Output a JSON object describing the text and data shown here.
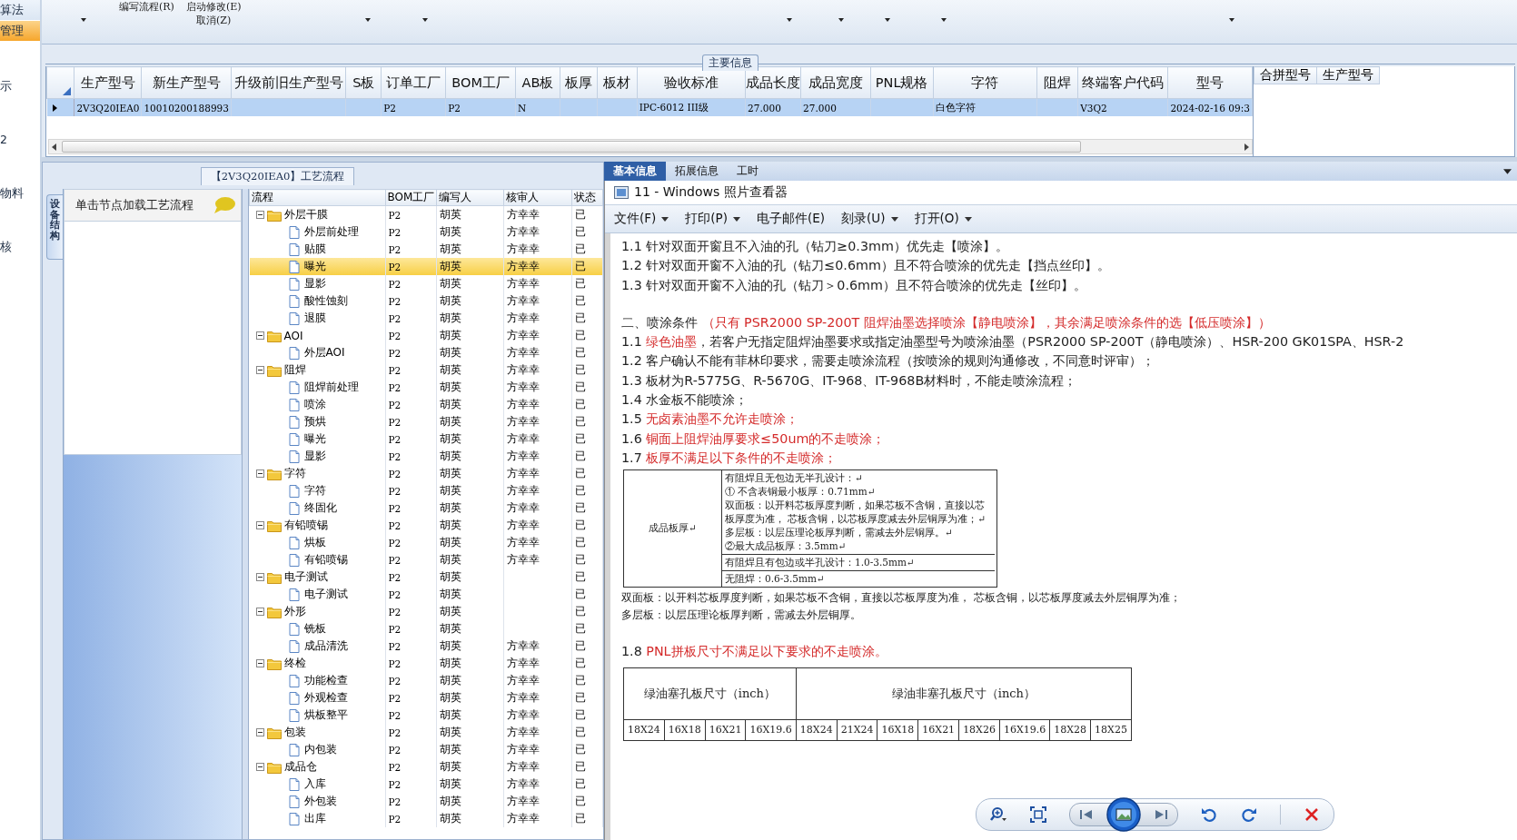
{
  "sidebar": {
    "items": [
      {
        "label": "算法",
        "selected": false
      },
      {
        "label": "管理",
        "selected": true
      },
      {
        "label": "示",
        "selected": false
      },
      {
        "label": "2",
        "selected": false
      },
      {
        "label": "物料",
        "selected": false
      },
      {
        "label": "核",
        "selected": false
      }
    ]
  },
  "toolbar": {
    "items": [
      {
        "kind": "arrow"
      },
      {
        "kind": "label",
        "lines": [
          "编写流程(R)"
        ]
      },
      {
        "kind": "label",
        "lines": [
          "启动修改(E)",
          "取消(Z)"
        ]
      },
      {
        "kind": "arrow"
      },
      {
        "kind": "arrow"
      },
      {
        "kind": "arrow"
      },
      {
        "kind": "arrow"
      },
      {
        "kind": "arrow"
      },
      {
        "kind": "arrow"
      },
      {
        "kind": "arrow"
      }
    ]
  },
  "main_info": {
    "title": "主要信息",
    "columns": [
      "生产型号",
      "新生产型号",
      "升级前旧生产型号",
      "S板",
      "订单工厂",
      "BOM工厂",
      "AB板",
      "板厚",
      "板材",
      "验收标准",
      "成品长度",
      "成品宽度",
      "PNL规格",
      "字符",
      "阻焊",
      "终端客户代码",
      "型号"
    ],
    "rows": [
      {
        "selected": true,
        "cells": [
          "2V3Q20IEA0",
          "10010200188993",
          "",
          "",
          "P2",
          "P2",
          "N",
          "",
          "",
          "IPC-6012 III级",
          "27.000",
          "27.000",
          "",
          "白色字符",
          "",
          "V3Q2",
          "2024-02-16 09:3"
        ]
      }
    ]
  },
  "merge_grid": {
    "columns": [
      "合拼型号",
      "生产型号"
    ]
  },
  "process_panel": {
    "title": "【2V3Q20IEA0】工艺流程",
    "side_tab": "设备结构",
    "hint": "单击节点加载工艺流程",
    "columns": [
      "流程",
      "BOM工厂",
      "编写人",
      "核审人",
      "状态"
    ],
    "tree": [
      {
        "kind": "folder",
        "name": "外层干膜",
        "bom": "P2",
        "writer": "胡英",
        "reviewer": "方幸幸",
        "status": "已",
        "expanded": true,
        "selected": false,
        "children": [
          {
            "kind": "step",
            "name": "外层前处理",
            "bom": "P2",
            "writer": "胡英",
            "reviewer": "方幸幸",
            "status": "已",
            "selected": false
          },
          {
            "kind": "step",
            "name": "贴膜",
            "bom": "P2",
            "writer": "胡英",
            "reviewer": "方幸幸",
            "status": "已",
            "selected": false
          },
          {
            "kind": "step",
            "name": "曝光",
            "bom": "P2",
            "writer": "胡英",
            "reviewer": "方幸幸",
            "status": "已",
            "selected": true
          },
          {
            "kind": "step",
            "name": "显影",
            "bom": "P2",
            "writer": "胡英",
            "reviewer": "方幸幸",
            "status": "已",
            "selected": false
          },
          {
            "kind": "step",
            "name": "酸性蚀刻",
            "bom": "P2",
            "writer": "胡英",
            "reviewer": "方幸幸",
            "status": "已",
            "selected": false
          },
          {
            "kind": "step",
            "name": "退膜",
            "bom": "P2",
            "writer": "胡英",
            "reviewer": "方幸幸",
            "status": "已",
            "selected": false
          }
        ]
      },
      {
        "kind": "folder",
        "name": "AOI",
        "bom": "P2",
        "writer": "胡英",
        "reviewer": "方幸幸",
        "status": "已",
        "expanded": true,
        "selected": false,
        "children": [
          {
            "kind": "step",
            "name": "外层AOI",
            "bom": "P2",
            "writer": "胡英",
            "reviewer": "方幸幸",
            "status": "已",
            "selected": false
          }
        ]
      },
      {
        "kind": "folder",
        "name": "阻焊",
        "bom": "P2",
        "writer": "胡英",
        "reviewer": "方幸幸",
        "status": "已",
        "expanded": true,
        "selected": false,
        "children": [
          {
            "kind": "step",
            "name": "阻焊前处理",
            "bom": "P2",
            "writer": "胡英",
            "reviewer": "方幸幸",
            "status": "已",
            "selected": false
          },
          {
            "kind": "step",
            "name": "喷涂",
            "bom": "P2",
            "writer": "胡英",
            "reviewer": "方幸幸",
            "status": "已",
            "selected": false
          },
          {
            "kind": "step",
            "name": "预烘",
            "bom": "P2",
            "writer": "胡英",
            "reviewer": "方幸幸",
            "status": "已",
            "selected": false
          },
          {
            "kind": "step",
            "name": "曝光",
            "bom": "P2",
            "writer": "胡英",
            "reviewer": "方幸幸",
            "status": "已",
            "selected": false
          },
          {
            "kind": "step",
            "name": "显影",
            "bom": "P2",
            "writer": "胡英",
            "reviewer": "方幸幸",
            "status": "已",
            "selected": false
          }
        ]
      },
      {
        "kind": "folder",
        "name": "字符",
        "bom": "P2",
        "writer": "胡英",
        "reviewer": "方幸幸",
        "status": "已",
        "expanded": true,
        "selected": false,
        "children": [
          {
            "kind": "step",
            "name": "字符",
            "bom": "P2",
            "writer": "胡英",
            "reviewer": "方幸幸",
            "status": "已",
            "selected": false
          },
          {
            "kind": "step",
            "name": "终固化",
            "bom": "P2",
            "writer": "胡英",
            "reviewer": "方幸幸",
            "status": "已",
            "selected": false
          }
        ]
      },
      {
        "kind": "folder",
        "name": "有铅喷锡",
        "bom": "P2",
        "writer": "胡英",
        "reviewer": "方幸幸",
        "status": "已",
        "expanded": true,
        "selected": false,
        "children": [
          {
            "kind": "step",
            "name": "烘板",
            "bom": "P2",
            "writer": "胡英",
            "reviewer": "方幸幸",
            "status": "已",
            "selected": false
          },
          {
            "kind": "step",
            "name": "有铅喷锡",
            "bom": "P2",
            "writer": "胡英",
            "reviewer": "方幸幸",
            "status": "已",
            "selected": false
          }
        ]
      },
      {
        "kind": "folder",
        "name": "电子测试",
        "bom": "P2",
        "writer": "胡英",
        "status": "已",
        "expanded": true,
        "selected": false,
        "children": [
          {
            "kind": "step",
            "name": "电子测试",
            "bom": "P2",
            "writer": "胡英",
            "status": "已",
            "selected": false
          }
        ]
      },
      {
        "kind": "folder",
        "name": "外形",
        "bom": "P2",
        "writer": "胡英",
        "status": "已",
        "expanded": true,
        "selected": false,
        "children": [
          {
            "kind": "step",
            "name": "铣板",
            "bom": "P2",
            "writer": "胡英",
            "status": "已",
            "selected": false
          },
          {
            "kind": "step",
            "name": "成品清洗",
            "bom": "P2",
            "writer": "胡英",
            "reviewer": "方幸幸",
            "status": "已",
            "selected": false
          }
        ]
      },
      {
        "kind": "folder",
        "name": "终检",
        "bom": "P2",
        "writer": "胡英",
        "reviewer": "方幸幸",
        "status": "已",
        "expanded": true,
        "selected": false,
        "children": [
          {
            "kind": "step",
            "name": "功能检查",
            "bom": "P2",
            "writer": "胡英",
            "reviewer": "方幸幸",
            "status": "已",
            "selected": false
          },
          {
            "kind": "step",
            "name": "外观检查",
            "bom": "P2",
            "writer": "胡英",
            "reviewer": "方幸幸",
            "status": "已",
            "selected": false
          },
          {
            "kind": "step",
            "name": "烘板整平",
            "bom": "P2",
            "writer": "胡英",
            "reviewer": "方幸幸",
            "status": "已",
            "selected": false
          }
        ]
      },
      {
        "kind": "folder",
        "name": "包装",
        "bom": "P2",
        "writer": "胡英",
        "reviewer": "方幸幸",
        "status": "已",
        "expanded": true,
        "selected": false,
        "children": [
          {
            "kind": "step",
            "name": "内包装",
            "bom": "P2",
            "writer": "胡英",
            "reviewer": "方幸幸",
            "status": "已",
            "selected": false
          }
        ]
      },
      {
        "kind": "folder",
        "name": "成品仓",
        "bom": "P2",
        "writer": "胡英",
        "reviewer": "方幸幸",
        "status": "已",
        "expanded": true,
        "selected": false,
        "children": [
          {
            "kind": "step",
            "name": "入库",
            "bom": "P2",
            "writer": "胡英",
            "reviewer": "方幸幸",
            "status": "已",
            "selected": false
          },
          {
            "kind": "step",
            "name": "外包装",
            "bom": "P2",
            "writer": "胡英",
            "reviewer": "方幸幸",
            "status": "已",
            "selected": false
          },
          {
            "kind": "step",
            "name": "出库",
            "bom": "P2",
            "writer": "胡英",
            "reviewer": "方幸幸",
            "status": "已",
            "selected": false
          }
        ]
      }
    ]
  },
  "tabs": [
    {
      "label": "基本信息",
      "selected": true
    },
    {
      "label": "拓展信息",
      "selected": false
    },
    {
      "label": "工时",
      "selected": false
    }
  ],
  "viewer": {
    "title": "11 - Windows 照片查看器",
    "menu": [
      {
        "label": "文件(F)",
        "dropdown": true
      },
      {
        "label": "打印(P)",
        "dropdown": true
      },
      {
        "label": "电子邮件(E)",
        "dropdown": false
      },
      {
        "label": "刻录(U)",
        "dropdown": true
      },
      {
        "label": "打开(O)",
        "dropdown": true
      }
    ],
    "document": [
      {
        "kind": "line",
        "parts": [
          {
            "text": "1.1 针对双面开窗且不入油的孔（钻刀≥0.3mm）优先走【喷涂】。",
            "highlight": false
          }
        ]
      },
      {
        "kind": "line",
        "parts": [
          {
            "text": "1.2 针对双面开窗不入油的孔（钻刀≤0.6mm）且不符合喷涂的优先走【挡点丝印】。",
            "highlight": false
          }
        ]
      },
      {
        "kind": "line",
        "parts": [
          {
            "text": "1.3 针对双面开窗不入油的孔（钻刀＞0.6mm）且不符合喷涂的优先走【丝印】。",
            "highlight": false
          }
        ]
      },
      {
        "kind": "section",
        "parts": [
          {
            "text": "二、喷涂条件 ",
            "highlight": false
          },
          {
            "text": "（只有 PSR2000 SP-200T 阻焊油墨选择喷涂【静电喷涂】，其余满足喷涂条件的选【低压喷涂】）",
            "highlight": true
          }
        ]
      },
      {
        "kind": "line",
        "parts": [
          {
            "text": "1.1 ",
            "highlight": false
          },
          {
            "text": "绿色油墨",
            "highlight": true
          },
          {
            "text": "，若客户无指定阻焊油墨要求或指定油墨型号为喷涂油墨（PSR2000 SP-200T（静电喷涂）、HSR-200 GK01SPA、HSR-2",
            "highlight": false
          }
        ]
      },
      {
        "kind": "line",
        "parts": [
          {
            "text": "1.2 客户确认不能有菲林印要求，需要走喷涂流程（按喷涂的规则沟通修改，不同意时评审）；",
            "highlight": false
          }
        ]
      },
      {
        "kind": "line",
        "parts": [
          {
            "text": "1.3 板材为R-5775G、R-5670G、IT-968、IT-968B材料时，不能走喷涂流程；",
            "highlight": false
          }
        ]
      },
      {
        "kind": "line",
        "parts": [
          {
            "text": "1.4 水金板不能喷涂；",
            "highlight": false
          }
        ]
      },
      {
        "kind": "line",
        "parts": [
          {
            "text": "1.5 ",
            "highlight": false
          },
          {
            "text": "无卤素油墨不允许走喷涂；",
            "highlight": true
          }
        ]
      },
      {
        "kind": "line",
        "parts": [
          {
            "text": "1.6 ",
            "highlight": false
          },
          {
            "text": "铜面上阻焊油厚要求≤50um的不走喷涂；",
            "highlight": true
          }
        ]
      },
      {
        "kind": "line",
        "parts": [
          {
            "text": "1.7 ",
            "highlight": false
          },
          {
            "text": "板厚不满足以下条件的不走喷涂；",
            "highlight": true
          }
        ]
      },
      {
        "kind": "thickness_table",
        "label": "成品板厚↵",
        "rows": [
          {
            "lines": [
              "有阻焊且无包边无半孔设计：↵",
              "①  不含表铜最小板厚：0.71mm↵",
              "双面板：以开料芯板厚度判断，如果芯板不含铜，直接以芯板厚度为准， 芯板含铜，以芯板厚度减去外层铜厚为准；↵",
              "多层板：以层压理论板厚判断，需减去外层铜厚。↵",
              "②最大成品板厚：3.5mm↵"
            ]
          },
          {
            "lines": [
              "有阻焊且有包边或半孔设计：1.0-3.5mm↵"
            ]
          },
          {
            "lines": [
              "无阻焊：0.6-3.5mm↵"
            ]
          }
        ]
      },
      {
        "kind": "note",
        "parts": [
          {
            "text": "双面板：以开料芯板厚度判断，如果芯板不含铜，直接以芯板厚度为准， 芯板含铜，以芯板厚度减去外层铜厚为准；",
            "highlight": false
          }
        ]
      },
      {
        "kind": "note",
        "parts": [
          {
            "text": "多层板：以层压理论板厚判断，需减去外层铜厚。",
            "highlight": false
          }
        ]
      },
      {
        "kind": "section",
        "parts": [
          {
            "text": "1.8 ",
            "highlight": false
          },
          {
            "text": "PNL拼板尺寸不满足以下要求的不走喷涂。",
            "highlight": true
          }
        ]
      },
      {
        "kind": "size_table",
        "groups": [
          {
            "title": "绿油塞孔板尺寸（inch）",
            "sizes": [
              "18X24",
              "16X18",
              "16X21",
              "16X19.6"
            ]
          },
          {
            "title": "绿油非塞孔板尺寸（inch）",
            "sizes": [
              "18X24",
              "21X24",
              "16X18",
              "16X21",
              "18X26",
              "16X19.6",
              "18X28",
              "18X25"
            ]
          }
        ]
      }
    ]
  }
}
